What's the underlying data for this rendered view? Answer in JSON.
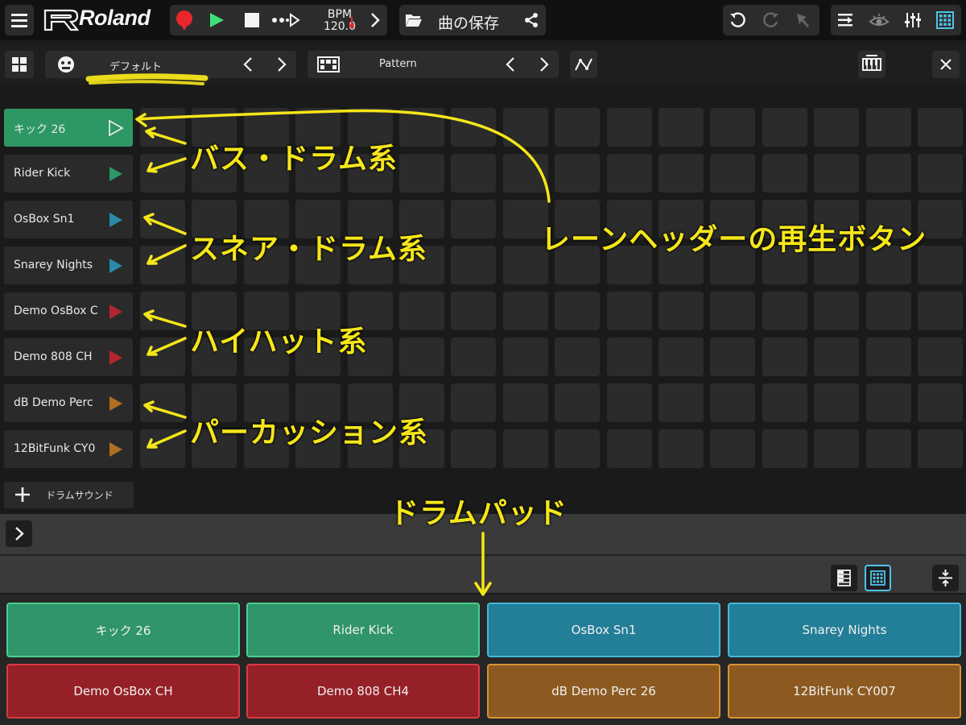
{
  "toolbar": {
    "logo": "Roland",
    "bpm_label": "BPM",
    "bpm_value": "120.0",
    "save_label": "曲の保存"
  },
  "subbar": {
    "kit_name": "デフォルト",
    "pattern_name": "Pattern"
  },
  "lanes": [
    {
      "name": "キック 26",
      "color": "#2e9865"
    },
    {
      "name": "Rider Kick",
      "color": "#2e9865"
    },
    {
      "name": "OsBox Sn1",
      "color": "#2a8aa8"
    },
    {
      "name": "Snarey Nights",
      "color": "#2a8aa8"
    },
    {
      "name": "Demo OsBox C",
      "color": "#b3262e"
    },
    {
      "name": "Demo 808 CH",
      "color": "#b3262e"
    },
    {
      "name": "dB Demo Perc",
      "color": "#b06e22"
    },
    {
      "name": "12BitFunk CY0",
      "color": "#b06e22"
    }
  ],
  "add_drum_label": "ドラムサウンド",
  "pads": [
    {
      "label": "キック 26",
      "bg": "#30956a",
      "border": "#4bd08e"
    },
    {
      "label": "Rider Kick",
      "bg": "#30956a",
      "border": "#4bd08e"
    },
    {
      "label": "OsBox Sn1",
      "bg": "#237e98",
      "border": "#45b8d8"
    },
    {
      "label": "Snarey Nights",
      "bg": "#237e98",
      "border": "#45b8d8"
    },
    {
      "label": "Demo OsBox CH",
      "bg": "#962027",
      "border": "#d83a44"
    },
    {
      "label": "Demo 808 CH4",
      "bg": "#962027",
      "border": "#d83a44"
    },
    {
      "label": "dB Demo Perc 26",
      "bg": "#8c5a20",
      "border": "#d89234"
    },
    {
      "label": "12BitFunk CY007",
      "bg": "#8c5a20",
      "border": "#d89234"
    }
  ],
  "annotations": {
    "bass": "バス・ドラム系",
    "snare": "スネア・ドラム系",
    "hihat": "ハイハット系",
    "perc": "パーカッション系",
    "lane_play": "レーンヘッダーの再生ボタン",
    "drum_pad": "ドラムパッド"
  },
  "colors": {
    "accent_green": "#2e9865",
    "highlight_yellow": "#f5e61a",
    "active_cyan": "#4fc3e8"
  }
}
